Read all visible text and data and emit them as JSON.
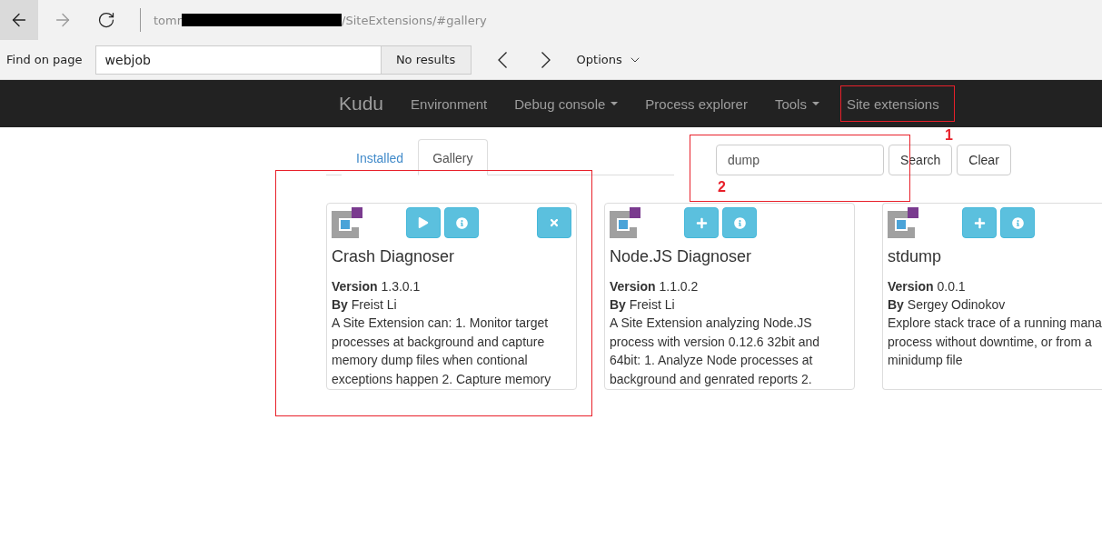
{
  "browser": {
    "back_enabled": true,
    "forward_enabled": false,
    "url_start": "tomr",
    "url_end": "/SiteExtensions/#gallery"
  },
  "find_bar": {
    "label": "Find on page",
    "value": "webjob",
    "status": "No results",
    "options": "Options"
  },
  "navbar": {
    "brand": "Kudu",
    "items": [
      {
        "label": "Environment",
        "dropdown": false
      },
      {
        "label": "Debug console",
        "dropdown": true
      },
      {
        "label": "Process explorer",
        "dropdown": false
      },
      {
        "label": "Tools",
        "dropdown": true
      },
      {
        "label": "Site extensions",
        "dropdown": false
      }
    ]
  },
  "tabs": [
    {
      "label": "Installed",
      "selected": false
    },
    {
      "label": "Gallery",
      "selected": true
    }
  ],
  "search": {
    "value": "dump",
    "buttons": [
      "Search",
      "Clear"
    ]
  },
  "cards": [
    {
      "title": "Crash Diagnoser",
      "version_label": "Version",
      "version": "1.3.0.1",
      "by_label": "By",
      "author": "Freist Li",
      "actions": [
        {
          "kind": "run"
        },
        {
          "kind": "info"
        },
        {
          "kind": "remove"
        }
      ],
      "description": [
        "A Site Extension can: 1. Monitor target",
        "processes at background and capture",
        "memory dump files when contional",
        "exceptions happen 2. Capture memory"
      ]
    },
    {
      "title": "Node.JS Diagnoser",
      "version_label": "Version",
      "version": "1.1.0.2",
      "by_label": "By",
      "author": "Freist Li",
      "actions": [
        {
          "kind": "add"
        },
        {
          "kind": "info"
        }
      ],
      "description": [
        "A Site Extension analyzing Node.JS",
        "process with version 0.12.6 32bit and",
        "64bit: 1. Analyze Node processes at",
        "background and genrated reports 2."
      ]
    },
    {
      "title": "stdump",
      "version_label": "Version",
      "version": "0.0.1",
      "by_label": "By",
      "author": "Sergey Odinokov",
      "actions": [
        {
          "kind": "add"
        },
        {
          "kind": "info"
        }
      ],
      "description": [
        "Explore stack trace of a running mana",
        "process without downtime, or from a",
        "minidump file"
      ]
    }
  ],
  "annotations": [
    {
      "kind": "box"
    },
    {
      "kind": "label",
      "text": "1"
    },
    {
      "kind": "box"
    },
    {
      "kind": "label",
      "text": "2"
    },
    {
      "kind": "box"
    }
  ]
}
